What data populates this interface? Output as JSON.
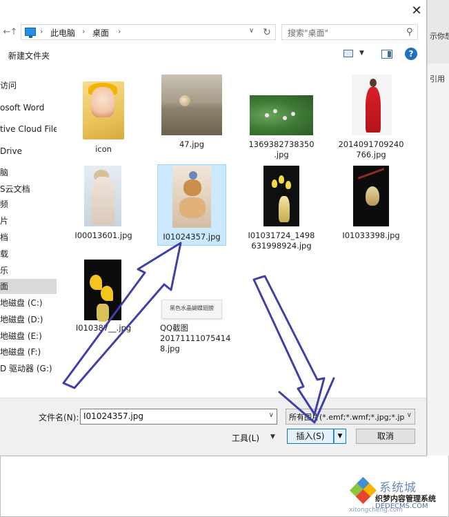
{
  "dialog": {
    "close_label": "✕"
  },
  "nav": {
    "back": "←",
    "forward": "→",
    "up": "↑",
    "breadcrumbs": [
      "此电脑",
      "桌面"
    ],
    "search_placeholder": "搜索\"桌面\""
  },
  "toolbar": {
    "new_folder": "新建文件夹",
    "help": "?"
  },
  "sidebar": {
    "items": [
      {
        "label": "访问"
      },
      {
        "label": "osoft Word"
      },
      {
        "label": "tive Cloud Files"
      },
      {
        "label": "Drive"
      },
      {
        "label": "脑"
      },
      {
        "label": "S云文档"
      },
      {
        "label": "频"
      },
      {
        "label": "片"
      },
      {
        "label": "档"
      },
      {
        "label": "载"
      },
      {
        "label": "乐"
      },
      {
        "label": "面"
      },
      {
        "label": "地磁盘 (C:)"
      },
      {
        "label": "地磁盘 (D:)"
      },
      {
        "label": "地磁盘 (E:)"
      },
      {
        "label": "地磁盘 (F:)"
      },
      {
        "label": "D 驱动器 (G:)"
      }
    ]
  },
  "files": [
    {
      "name": "icon",
      "kind": "folder"
    },
    {
      "name": "47.jpg",
      "kind": "image"
    },
    {
      "name_lines": [
        "1369382738350",
        ".jpg"
      ],
      "kind": "image"
    },
    {
      "name_lines": [
        "2014091709240",
        "766.jpg"
      ],
      "kind": "image"
    },
    {
      "name": "I00013601.jpg",
      "kind": "image"
    },
    {
      "name": "I01024357.jpg",
      "kind": "image",
      "selected": true
    },
    {
      "name_lines": [
        "I01031724_1498",
        "631998924.jpg"
      ],
      "kind": "image"
    },
    {
      "name": "I01033398.jpg",
      "kind": "image"
    },
    {
      "name": "I010387__.jpg",
      "kind": "image"
    },
    {
      "name_lines": [
        "QQ截图",
        "20171111075414",
        "8.jpg"
      ],
      "kind": "image",
      "thumb_text": "黑色水晶蝴蝶翅膀"
    }
  ],
  "bottom": {
    "filename_label": "文件名(N):",
    "filename_value": "I01024357.jpg",
    "filetype_value": "所有图片(*.emf;*.wmf;*.jpg;*.jp",
    "tools_label": "工具(L)",
    "insert_label": "插入(S)",
    "cancel_label": "取消"
  },
  "background_app": {
    "text_1": "示你想",
    "text_2": "引用"
  },
  "watermark": {
    "title": "系统城",
    "line_1": "织梦内容管理系统",
    "line_2": "DEDECMS.COM",
    "line_3": "xitongcheng.com"
  },
  "colors": {
    "accent": "#0078d7",
    "selection": "#cce8ff",
    "annotation_arrow": "#3f3fa8"
  }
}
